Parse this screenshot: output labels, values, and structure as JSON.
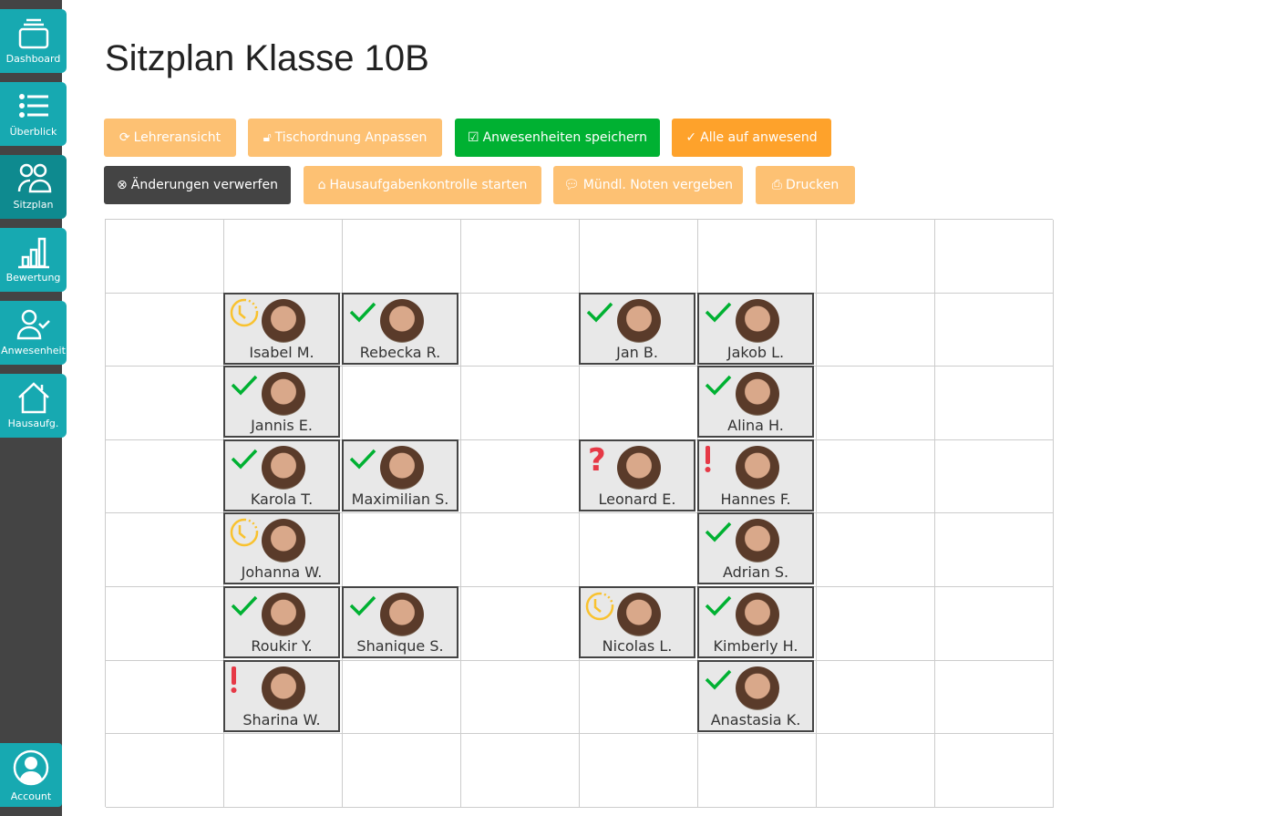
{
  "sidebar": {
    "items": [
      {
        "label": "Dashboard",
        "icon": "layers-icon"
      },
      {
        "label": "Überblick",
        "icon": "list-icon"
      },
      {
        "label": "Sitzplan",
        "icon": "users-icon",
        "active": true
      },
      {
        "label": "Bewertung",
        "icon": "bar-chart-icon"
      },
      {
        "label": "Anwesenheit",
        "icon": "user-check-icon"
      },
      {
        "label": "Hausaufg.",
        "icon": "home-icon"
      }
    ],
    "account": "Account"
  },
  "page": {
    "title": "Sitzplan Klasse 10B"
  },
  "toolbar": {
    "lehreransicht": "Lehreransicht",
    "tischordnung": "Tischordnung Anpassen",
    "speichern": "Anwesenheiten speichern",
    "alle": "Alle auf anwesend",
    "verwerfen": "Änderungen verwerfen",
    "hausaufgaben": "Hausaufgabenkontrolle starten",
    "noten": "Mündl. Noten vergeben",
    "drucken": "Drucken"
  },
  "colors": {
    "teal": "#17a9b1",
    "green": "#00b132",
    "orange": "#fea22b",
    "light_orange": "#fdc173",
    "dark": "#444444",
    "present": "#00b132",
    "late": "#f9c22e",
    "alert": "#e63946"
  },
  "students": [
    {
      "name": "Isabel M.",
      "row": 1,
      "col": 1,
      "status": "late"
    },
    {
      "name": "Rebecka R.",
      "row": 1,
      "col": 2,
      "status": "present"
    },
    {
      "name": "Jan B.",
      "row": 1,
      "col": 4,
      "status": "present"
    },
    {
      "name": "Jakob L.",
      "row": 1,
      "col": 5,
      "status": "present"
    },
    {
      "name": "Jannis E.",
      "row": 2,
      "col": 1,
      "status": "present"
    },
    {
      "name": "Alina H.",
      "row": 2,
      "col": 5,
      "status": "present"
    },
    {
      "name": "Karola T.",
      "row": 3,
      "col": 1,
      "status": "present"
    },
    {
      "name": "Maximilian S.",
      "row": 3,
      "col": 2,
      "status": "present"
    },
    {
      "name": "Leonard E.",
      "row": 3,
      "col": 4,
      "status": "unknown"
    },
    {
      "name": "Hannes F.",
      "row": 3,
      "col": 5,
      "status": "absent"
    },
    {
      "name": "Johanna W.",
      "row": 4,
      "col": 1,
      "status": "late"
    },
    {
      "name": "Adrian S.",
      "row": 4,
      "col": 5,
      "status": "present"
    },
    {
      "name": "Roukir Y.",
      "row": 5,
      "col": 1,
      "status": "present"
    },
    {
      "name": "Shanique S.",
      "row": 5,
      "col": 2,
      "status": "present"
    },
    {
      "name": "Nicolas L.",
      "row": 5,
      "col": 4,
      "status": "late"
    },
    {
      "name": "Kimberly H.",
      "row": 5,
      "col": 5,
      "status": "present"
    },
    {
      "name": "Sharina W.",
      "row": 6,
      "col": 1,
      "status": "absent"
    },
    {
      "name": "Anastasia K.",
      "row": 6,
      "col": 5,
      "status": "present"
    }
  ]
}
